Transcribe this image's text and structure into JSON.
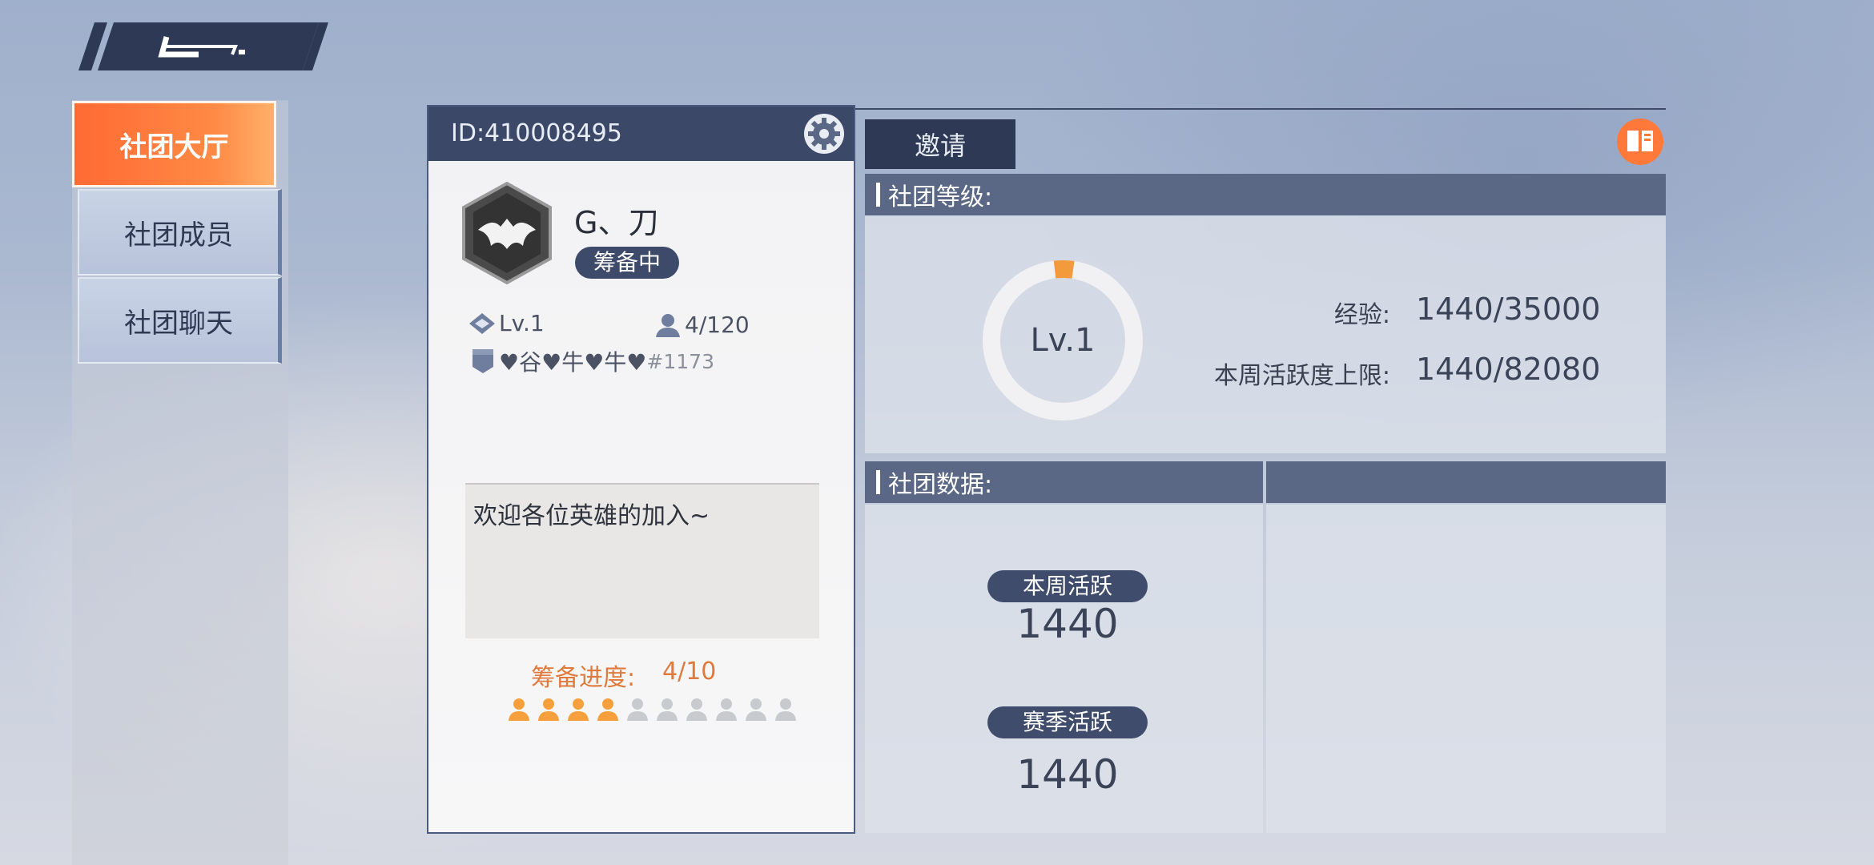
{
  "nav": {
    "items": [
      {
        "label": "社团大厅",
        "active": true
      },
      {
        "label": "社团成员",
        "active": false
      },
      {
        "label": "社团聊天",
        "active": false
      }
    ]
  },
  "profile": {
    "id_text": "ID:410008495",
    "name": "G、刀",
    "status": "筹备中",
    "level": "Lv.1",
    "members": "4/120",
    "owner": "♥谷♥牛♥牛♥",
    "owner_tag": "#1173",
    "description": "欢迎各位英雄的加入~",
    "progress_label": "筹备进度:",
    "progress_value": "4/10",
    "progress_filled": 4,
    "progress_total": 10
  },
  "panel": {
    "invite_label": "邀请",
    "level_section": {
      "title": "社团等级:",
      "ring_label": "Lv.1",
      "exp_label": "经验:",
      "exp_value": "1440/35000",
      "weekly_cap_label": "本周活跃度上限:",
      "weekly_cap_value": "1440/82080"
    },
    "data_section": {
      "title": "社团数据:",
      "weekly_label": "本周活跃",
      "weekly_value": "1440",
      "season_label": "赛季活跃",
      "season_value": "1440"
    }
  },
  "colors": {
    "accent": "#ff7a3a",
    "navy": "#3c4868",
    "progress_on": "#f5a03c",
    "progress_off": "#c8cacd"
  }
}
